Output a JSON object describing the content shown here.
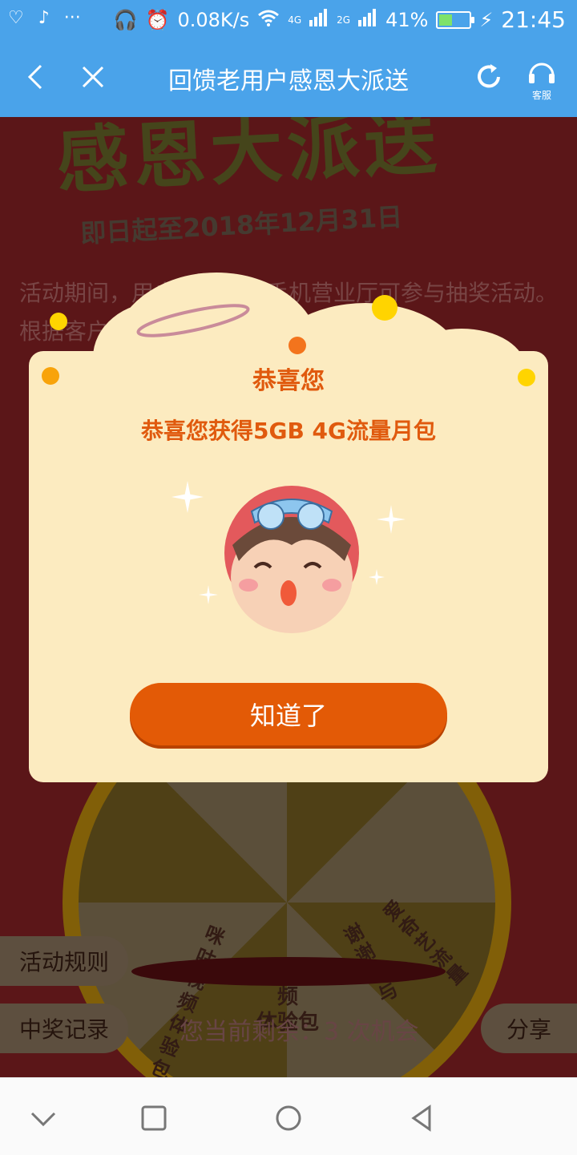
{
  "status_bar": {
    "speed": "0.08K/s",
    "net1": "4G",
    "net2": "2G",
    "battery": "41%",
    "time": "21:45"
  },
  "header": {
    "title": "回馈老用户感恩大派送",
    "service_label": "客服"
  },
  "banner": {
    "title_partial": "感恩大派送",
    "date_text": "即日起至2018年12月31日"
  },
  "description": "活动期间，用户登录移动手机营业厅可参与抽奖活动。根据客户等级可获得抽奖机会，奖品多",
  "wheel": {
    "segment_1": "咪咕视频体验包",
    "segment_2": "咪咕视频\n体验包",
    "segment_3": "谢谢参与",
    "segment_4": "爱奇艺流量"
  },
  "footer": {
    "rules": "活动规则",
    "records": "中奖记录",
    "remaining": "您当前剩余：3 次机会",
    "share": "分享"
  },
  "modal": {
    "title": "恭喜您",
    "prize": "恭喜您获得5GB 4G流量月包",
    "ok": "知道了"
  },
  "colors": {
    "header_blue": "#4aa3ea",
    "modal_bg": "#fcebc0",
    "accent_orange": "#e35a06",
    "page_red": "#8d2225"
  }
}
